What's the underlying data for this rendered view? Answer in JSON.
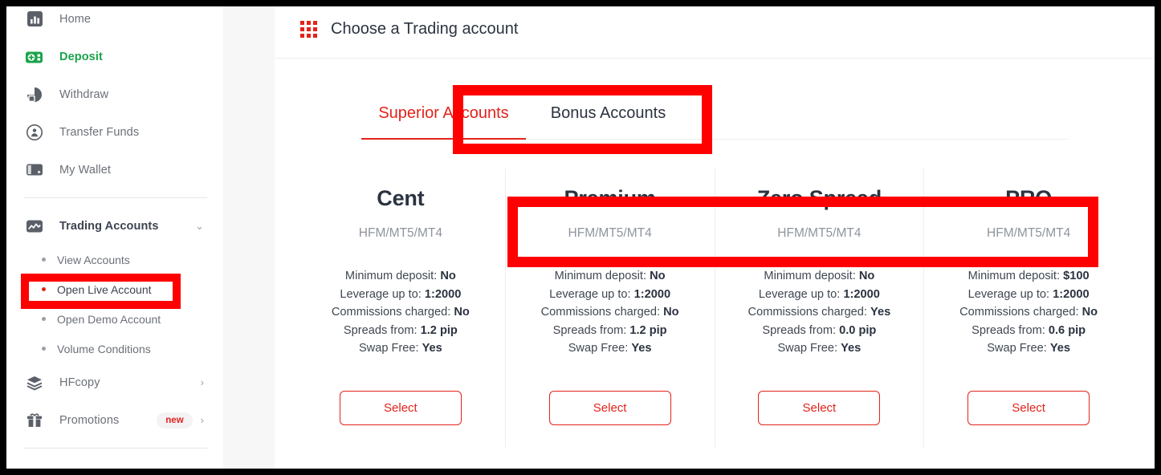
{
  "colors": {
    "brand_red": "#e2231a",
    "annotation_red": "#ff0000",
    "deposit_green": "#1aa34a"
  },
  "sidebar": {
    "items": [
      {
        "label": "Home",
        "icon": "bar-chart-icon"
      },
      {
        "label": "Deposit",
        "icon": "deposit-icon"
      },
      {
        "label": "Withdraw",
        "icon": "withdraw-icon"
      },
      {
        "label": "Transfer Funds",
        "icon": "transfer-funds-icon"
      },
      {
        "label": "My Wallet",
        "icon": "wallet-icon"
      }
    ],
    "trading_accounts": {
      "label": "Trading Accounts",
      "icon": "trading-accounts-icon",
      "chevron": "⌄"
    },
    "sub_items": [
      {
        "label": "View Accounts"
      },
      {
        "label": "Open Live Account"
      },
      {
        "label": "Open Demo Account"
      },
      {
        "label": "Volume Conditions"
      }
    ],
    "hfcopy": {
      "label": "HFcopy",
      "icon": "layers-icon",
      "chevron": "›"
    },
    "promotions": {
      "label": "Promotions",
      "icon": "gift-icon",
      "badge": "new",
      "chevron": "›"
    }
  },
  "main": {
    "header": {
      "title": "Choose a Trading account",
      "icon": "grid-apps-icon"
    },
    "tabs": [
      {
        "label": "Superior Accounts",
        "active": true
      },
      {
        "label": "Bonus Accounts",
        "active": false
      }
    ],
    "spec_labels": {
      "minimum_deposit": "Minimum deposit: ",
      "leverage": "Leverage up to: ",
      "commissions": "Commissions charged: ",
      "spreads": "Spreads from: ",
      "swap_free": "Swap Free: "
    },
    "select_label": "Select",
    "accounts": [
      {
        "name": "Cent",
        "platform": "HFM/MT5/MT4",
        "minimum_deposit": "No",
        "leverage": "1:2000",
        "commissions": "No",
        "spreads": "1.2 pip",
        "swap_free": "Yes"
      },
      {
        "name": "Premium",
        "platform": "HFM/MT5/MT4",
        "minimum_deposit": "No",
        "leverage": "1:2000",
        "commissions": "No",
        "spreads": "1.2 pip",
        "swap_free": "Yes"
      },
      {
        "name": "Zero Spread",
        "platform": "HFM/MT5/MT4",
        "minimum_deposit": "No",
        "leverage": "1:2000",
        "commissions": "Yes",
        "spreads": "0.0 pip",
        "swap_free": "Yes"
      },
      {
        "name": "PRO",
        "platform": "HFM/MT5/MT4",
        "minimum_deposit": "$100",
        "leverage": "1:2000",
        "commissions": "No",
        "spreads": "0.6 pip",
        "swap_free": "Yes"
      }
    ]
  }
}
